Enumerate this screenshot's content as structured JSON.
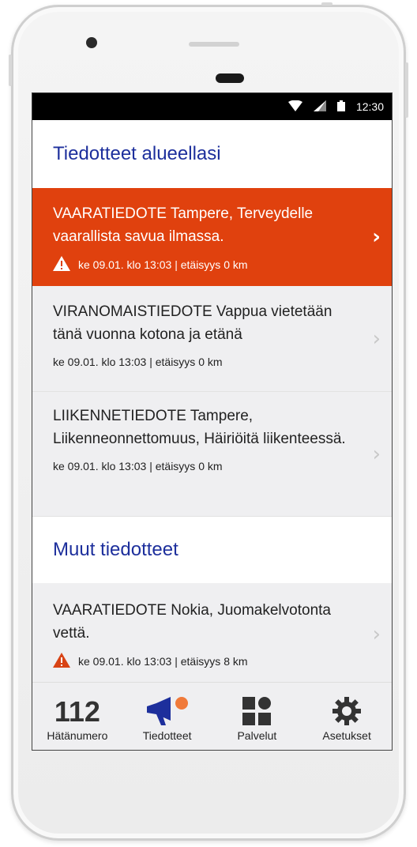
{
  "status_bar": {
    "time": "12:30"
  },
  "section_local": {
    "title": "Tiedotteet alueellasi"
  },
  "section_other": {
    "title": "Muut tiedotteet"
  },
  "local_items": [
    {
      "headline": "VAARATIEDOTE Tampere, Terveydelle vaarallista savua ilmassa.",
      "meta": "ke 09.01. klo 13:03 | etäisyys 0 km",
      "warning_icon": "warning-triangle-icon"
    },
    {
      "headline": "VIRANOMAISTIEDOTE Vappua vietetään tänä vuonna kotona ja etänä",
      "meta": "ke 09.01. klo 13:03 | etäisyys 0 km"
    },
    {
      "headline": "LIIKENNETIEDOTE Tampere, Liikenneonnettomuus, Häiriöitä liikenteessä.",
      "meta": "ke 09.01. klo 13:03 | etäisyys 0 km"
    }
  ],
  "other_items": [
    {
      "headline": "VAARATIEDOTE Nokia, Juomakelvotonta vettä.",
      "meta": "ke 09.01. klo 13:03 | etäisyys 8 km",
      "warning_icon": "warning-triangle-icon"
    }
  ],
  "tabs": [
    {
      "icon_text": "112",
      "label": "Hätänumero"
    },
    {
      "label": "Tiedotteet",
      "icon": "megaphone-icon"
    },
    {
      "label": "Palvelut",
      "icon": "grid-icon"
    },
    {
      "label": "Asetukset",
      "icon": "gear-icon"
    }
  ],
  "colors": {
    "accent": "#1d2f9c",
    "danger": "#e0410e",
    "notification_dot": "#f07a3a",
    "warning": "#d84315"
  }
}
